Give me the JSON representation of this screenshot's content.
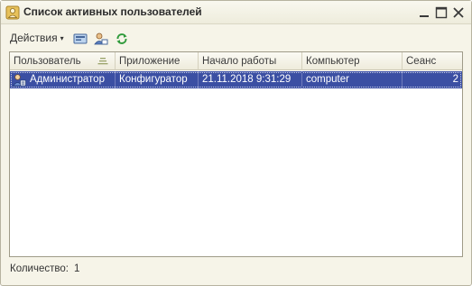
{
  "window": {
    "title": "Список активных пользователей"
  },
  "toolbar": {
    "actions_label": "Действия",
    "actions_caret": "▾"
  },
  "grid": {
    "columns": [
      "Пользователь",
      "Приложение",
      "Начало работы",
      "Компьютер",
      "Сеанс"
    ],
    "rows": [
      {
        "user": "Администратор",
        "app": "Конфигуратор",
        "start": "21.11.2018 9:31:29",
        "computer": "computer",
        "session": "2",
        "selected": true
      }
    ]
  },
  "footer": {
    "count_label": "Количество:",
    "count_value": "1"
  },
  "colors": {
    "selection": "#3b4fa3",
    "window_bg": "#f6f4e8"
  }
}
